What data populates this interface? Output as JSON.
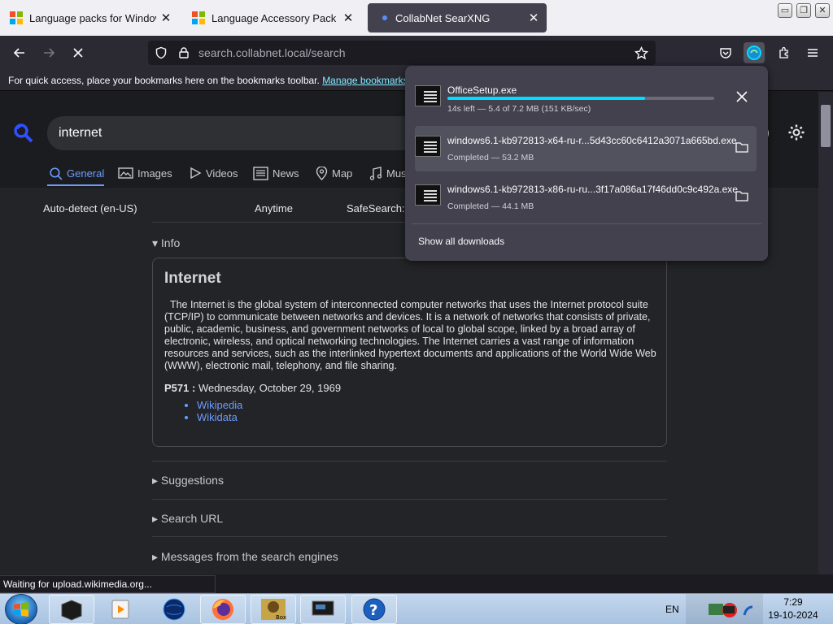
{
  "tabs": [
    {
      "title": "Language packs for Windows - ",
      "close": "✕",
      "active": false
    },
    {
      "title": "Language Accessory Pack for M",
      "close": "✕",
      "active": false
    },
    {
      "title": "CollabNet SearXNG",
      "close": "✕",
      "active": true
    }
  ],
  "window_controls": {
    "minimize": "▭",
    "maximize": "❐",
    "close": "✕"
  },
  "nav": {
    "url_host": "search.collabnet.local",
    "url_path": "/search"
  },
  "bookmarks_bar": {
    "message": "For quick access, place your bookmarks here on the bookmarks toolbar. ",
    "link": "Manage bookmarks…"
  },
  "search": {
    "query": "internet"
  },
  "categories": [
    {
      "label": "General",
      "icon": "search-icon",
      "active": true
    },
    {
      "label": "Images",
      "icon": "image-icon",
      "active": false
    },
    {
      "label": "Videos",
      "icon": "play-icon",
      "active": false
    },
    {
      "label": "News",
      "icon": "newspaper-icon",
      "active": false
    },
    {
      "label": "Map",
      "icon": "map-pin-icon",
      "active": false
    },
    {
      "label": "Mus",
      "icon": "music-icon",
      "active": false
    }
  ],
  "filters": {
    "language": "Auto-detect (en-US)",
    "time": "Anytime",
    "safesearch": "SafeSearch:"
  },
  "info": {
    "section_label": "▾ Info",
    "title": "Internet",
    "description": "The Internet is the global system of interconnected computer networks that uses the Internet protocol suite (TCP/IP) to communicate between networks and devices. It is a network of networks that consists of private, public, academic, business, and government networks of local to global scope, linked by a broad array of electronic, wireless, and optical networking technologies. The Internet carries a vast range of information resources and services, such as the interlinked hypertext documents and applications of the World Wide Web (WWW), electronic mail, telephony, and file sharing.",
    "p571_label": "P571 :",
    "p571_value": "Wednesday, October 29, 1969",
    "links": [
      "Wikipedia",
      "Wikidata"
    ]
  },
  "sections": [
    "▸ Suggestions",
    "▸ Search URL",
    "▸ Messages from the search engines"
  ],
  "status_text": "Waiting for upload.wikimedia.org...",
  "downloads": {
    "items": [
      {
        "name": "OfficeSetup.exe",
        "status": "14s left — 5.4 of 7.2 MB (151 KB/sec)",
        "progress": 0.74,
        "action": "close-icon"
      },
      {
        "name": "windows6.1-kb972813-x64-ru-r...5d43cc60c6412a3071a665bd.exe",
        "status": "Completed — 53.2 MB",
        "action": "folder-icon"
      },
      {
        "name": "windows6.1-kb972813-x86-ru-ru...3f17a086a17f46dd0c9c492a.exe",
        "status": "Completed — 44.1 MB",
        "action": "folder-icon"
      }
    ],
    "show_all": "Show all downloads"
  },
  "taskbar": {
    "lang": "EN",
    "time": "7:29",
    "date": "19-10-2024"
  },
  "colors": {
    "accent": "#6d9bff",
    "progress": "#00ddff",
    "toolbar": "#2b2a33"
  }
}
